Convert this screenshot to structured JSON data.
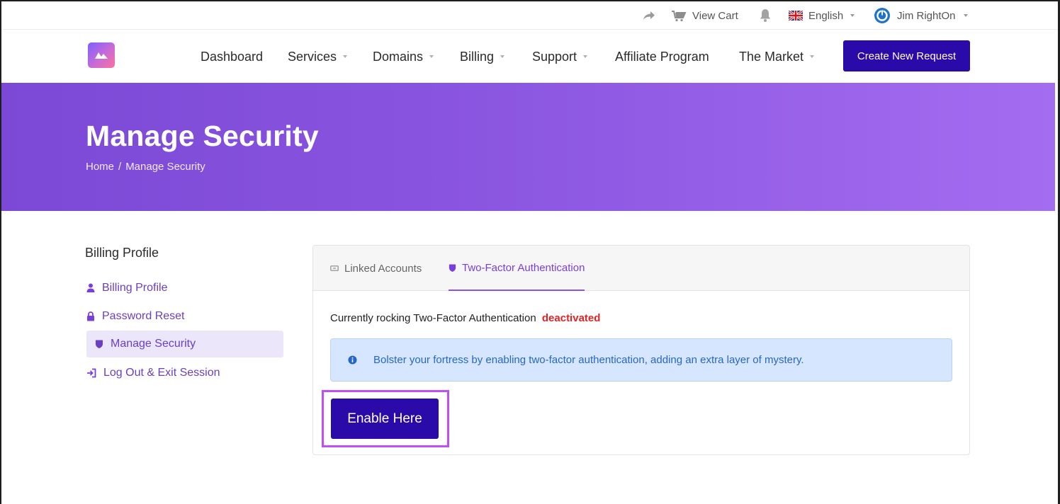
{
  "topbar": {
    "cart_label": "View Cart",
    "language_label": "English",
    "user_label": "Jim RightOn"
  },
  "nav": {
    "items": [
      {
        "label": "Dashboard"
      },
      {
        "label": "Services"
      },
      {
        "label": "Domains"
      },
      {
        "label": "Billing"
      },
      {
        "label": "Support"
      },
      {
        "label": "Affiliate Program"
      },
      {
        "label": "The Market"
      }
    ],
    "cta_label": "Create New Request"
  },
  "hero": {
    "title": "Manage Security",
    "breadcrumb": {
      "home": "Home",
      "separator": "/",
      "current": "Manage Security"
    }
  },
  "sidebar": {
    "title": "Billing Profile",
    "items": [
      {
        "label": "Billing Profile",
        "icon": "user-icon"
      },
      {
        "label": "Password Reset",
        "icon": "lock-icon"
      },
      {
        "label": "Manage Security",
        "icon": "shield-icon"
      },
      {
        "label": "Log Out & Exit Session",
        "icon": "logout-icon"
      }
    ]
  },
  "card": {
    "tabs": [
      {
        "label": "Linked Accounts",
        "icon": "link-icon"
      },
      {
        "label": "Two-Factor Authentication",
        "icon": "shield-icon"
      }
    ],
    "status_prefix": "Currently rocking Two-Factor Authentication",
    "status_value": "deactivated",
    "alert_text": "Bolster your fortress by enabling two-factor authentication, adding an extra layer of mystery.",
    "enable_label": "Enable Here"
  },
  "colors": {
    "primary": "#2a0aa8",
    "accent": "#8a52e8",
    "hero_start": "#7b49d6",
    "hero_end": "#a46cf0",
    "danger": "#e02424",
    "info_bg": "#d6e6ff",
    "highlight": "#c04ff5"
  }
}
